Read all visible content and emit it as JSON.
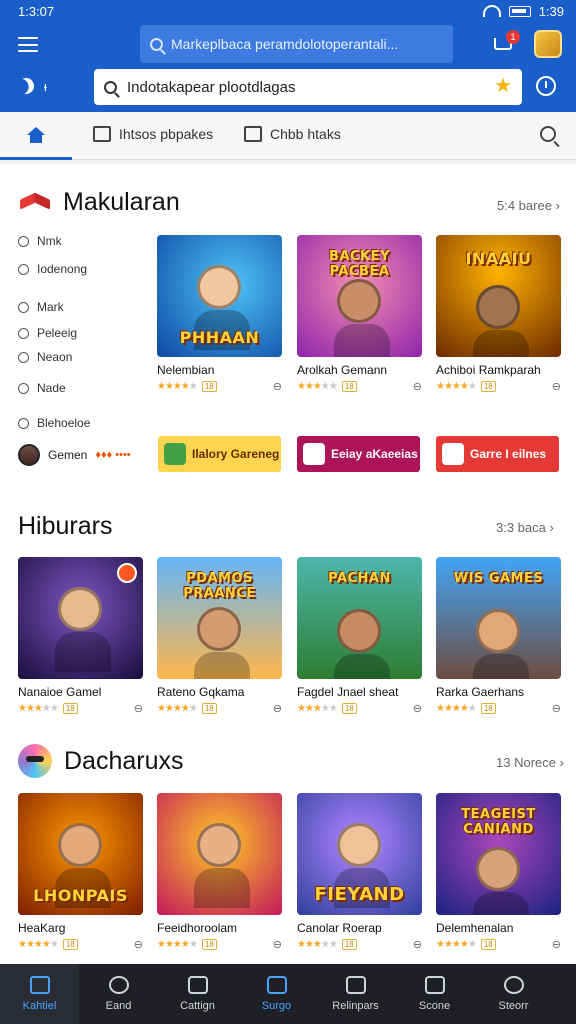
{
  "status": {
    "time": "1:3:07",
    "right_time": "1:39"
  },
  "header": {
    "search_placeholder": "Markeplbaca peramdolotoperantali...",
    "cart_badge": "1"
  },
  "search": {
    "moon_label": "ᵻ",
    "value": "Indotakapear plootdlagas"
  },
  "tabs": [
    {
      "label": "Ihtsos pbpakes"
    },
    {
      "label": "Chbb htaks"
    }
  ],
  "section1": {
    "title": "Makularan",
    "see_all": "5:4 baree",
    "filters": [
      {
        "label": "Nmk"
      },
      {
        "label": "Iodenong"
      },
      {
        "label": "Mark"
      },
      {
        "label": "Peleeig"
      },
      {
        "label": "Neaon"
      },
      {
        "label": "Nade"
      },
      {
        "label": "Blehoeloe"
      }
    ],
    "author": "Gemen",
    "author_hot": "♦♦♦ ••••",
    "cards": [
      {
        "title": "Nelembian",
        "thumb": "PHHAAN",
        "rating": 4
      },
      {
        "title": "Arolkah Gemann",
        "thumb": "BACKEY PACBEA",
        "rating": 3
      },
      {
        "title": "Achiboi Ramkparah",
        "thumb": "INAAIU",
        "rating": 4
      }
    ],
    "banners": [
      {
        "label": "Ilalory Gareneg"
      },
      {
        "label": "Eeiay aKaeeias"
      },
      {
        "label": "Garre I eilnes"
      }
    ]
  },
  "section2": {
    "title": "Hiburars",
    "see_all": "3:3 baca",
    "cards": [
      {
        "title": "Nanaioe Gamel",
        "thumb": "",
        "rating": 3
      },
      {
        "title": "Rateno Gqkama",
        "thumb": "PDAMOS PRAANCE",
        "rating": 4
      },
      {
        "title": "Fagdel Jnael sheat",
        "thumb": "PACHAN",
        "rating": 3
      },
      {
        "title": "Rarka Gaerhans",
        "thumb": "WIS GAMES",
        "rating": 4
      }
    ]
  },
  "section3": {
    "title": "Dacharuxs",
    "see_all": "13 Norece",
    "cards": [
      {
        "title": "HeaKarg",
        "thumb": "LHONPAIS",
        "rating": 4
      },
      {
        "title": "Feeidhoroolam",
        "thumb": "",
        "rating": 4
      },
      {
        "title": "Canolar Roerap",
        "thumb": "FIEYAND",
        "rating": 3
      },
      {
        "title": "Delemhenalan",
        "thumb": "TEAGEIST CANIAND",
        "rating": 4
      }
    ]
  },
  "bottom_nav": [
    {
      "label": "Kahtiel",
      "icon": "home-icon"
    },
    {
      "label": "Eand",
      "icon": "search-icon"
    },
    {
      "label": "Cattign",
      "icon": "gamepad-icon"
    },
    {
      "label": "Surgo",
      "icon": "cloud-icon"
    },
    {
      "label": "Relinpars",
      "icon": "grid-icon"
    },
    {
      "label": "Scone",
      "icon": "card-icon"
    },
    {
      "label": "Steorr",
      "icon": "user-icon"
    }
  ]
}
